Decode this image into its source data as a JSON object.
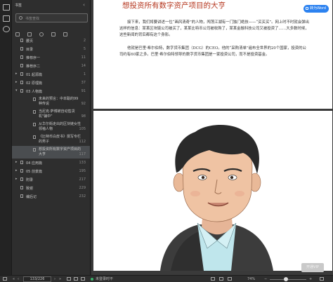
{
  "sidebar": {
    "title": "书签",
    "search_placeholder": "书签查找",
    "toc": [
      {
        "label": "腰页",
        "page": "2"
      },
      {
        "label": "目录",
        "page": "5"
      },
      {
        "label": "推荐序一",
        "page": "11"
      },
      {
        "label": "推荐序二",
        "page": "14"
      },
      {
        "label": "01 起源篇",
        "page": "1"
      },
      {
        "label": "02 原理篇",
        "page": "37"
      },
      {
        "label": "03 人物篇",
        "page": "91"
      }
    ],
    "subitems": [
      {
        "label": "未来的预言：中本聪的99种传说",
        "page": "92"
      },
      {
        "label": "当尼克·萨博被自动售货机\"骗中\"",
        "page": "98"
      },
      {
        "label": "从华尔街走出的区块链女性领袖人物",
        "page": "105"
      },
      {
        "label": "《比特币白皮书》撰写专栏的男子",
        "page": "112"
      },
      {
        "label": "想投资所有数字资产项目的大亨",
        "page": "117"
      }
    ],
    "toc_after": [
      {
        "label": "04 应用篇",
        "page": "133"
      },
      {
        "label": "05 前景篇",
        "page": "195"
      },
      {
        "label": "附录",
        "page": "217"
      },
      {
        "label": "致谢",
        "page": "229"
      },
      {
        "label": "编后记",
        "page": "232"
      }
    ]
  },
  "document": {
    "chapter_title": "想投资所有数字资产项目的大亨",
    "paragraph1": "接下来，我们将要讲述一位“画风清奇”的人物，闯荡江湖有一门独门绝技——“买买买”。网上时不时就会弹出这样的信息：某某区块链公司被买了，某某比特币公司被收购了，某某金融科技公司又被投资了……大多数时候，这些新闻的背后都有这个身影。",
    "paragraph2": "他就是巴里·希尔伯特，数字货币集团（DCG）的CEO。他的“采购清单”遍布全世界的20个国家，投资的公司约有60家之多。巴里·希尔伯特领导的数字货币集团是一家投资公司，而不是投资基金。",
    "convert_button": "转为Word",
    "vip_button": "开通VIP"
  },
  "statusbar": {
    "page_indicator": "133/226",
    "sync_status": "未登录时不",
    "zoom": "74%"
  },
  "colors": {
    "accent": "#2c82f0",
    "title_red": "#b5371f"
  }
}
